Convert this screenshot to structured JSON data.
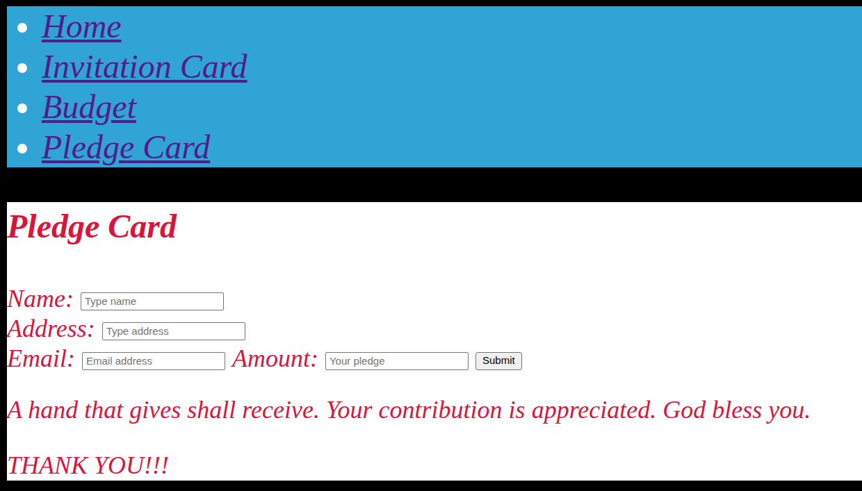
{
  "nav": {
    "items": [
      {
        "label": "Home"
      },
      {
        "label": "Invitation Card"
      },
      {
        "label": "Budget"
      },
      {
        "label": "Pledge Card"
      }
    ]
  },
  "pledge_card": {
    "title": "Pledge Card",
    "form": {
      "rows": [
        {
          "fields": [
            {
              "label": "Name:",
              "placeholder": "Type name"
            }
          ]
        },
        {
          "fields": [
            {
              "label": "Address:",
              "placeholder": "Type address"
            }
          ]
        },
        {
          "fields": [
            {
              "label": "Email:",
              "placeholder": "Email address"
            },
            {
              "label": "Amount:",
              "placeholder": "Your pledge"
            }
          ]
        }
      ],
      "submit": "Submit"
    },
    "message": "A hand that gives shall receive. Your contribution is appreciated. God bless you.",
    "thanks": "THANK YOU!!!"
  }
}
